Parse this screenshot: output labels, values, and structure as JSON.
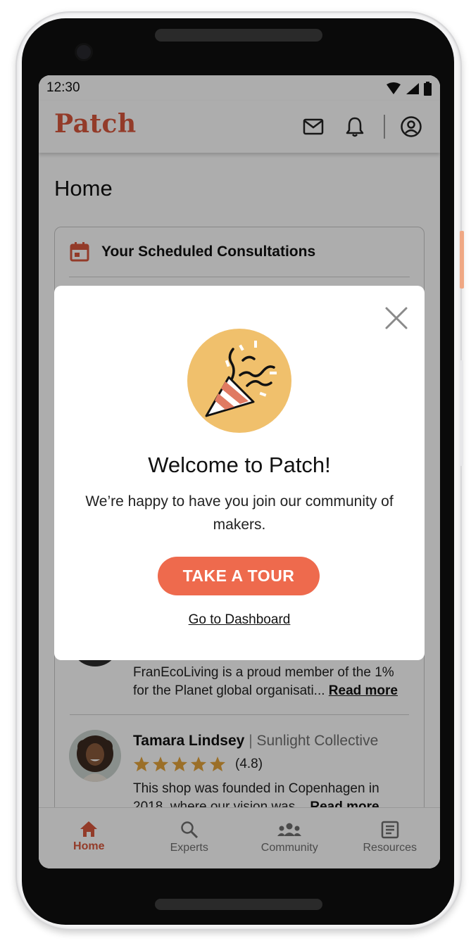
{
  "status_bar": {
    "time": "12:30"
  },
  "header": {
    "brand": "Patch"
  },
  "page": {
    "title": "Home"
  },
  "consultations": {
    "title": "Your Scheduled Consultations"
  },
  "reviews": [
    {
      "text": "FranEcoLiving is a proud member of the 1% for the Planet global organisati...",
      "read_more": "Read more"
    },
    {
      "name": "Tamara Lindsey",
      "separator": "|",
      "organization": "Sunlight Collective",
      "stars": 5,
      "rating": "(4.8)",
      "text": "This shop was founded in Copenhagen in 2018, where our vision was...",
      "read_more": "Read more"
    }
  ],
  "modal": {
    "title": "Welcome to Patch!",
    "body": "We’re happy to have you join our community of makers.",
    "primary_button": "TAKE A TOUR",
    "secondary_link": "Go to Dashboard"
  },
  "bottom_nav": {
    "items": [
      {
        "label": "Home",
        "icon": "home-icon",
        "active": true
      },
      {
        "label": "Experts",
        "icon": "search-icon",
        "active": false
      },
      {
        "label": "Community",
        "icon": "community-icon",
        "active": false
      },
      {
        "label": "Resources",
        "icon": "resources-icon",
        "active": false
      }
    ]
  },
  "colors": {
    "brand": "#d9583d",
    "accent_button": "#ee6a4d",
    "star": "#e5a43b",
    "party_circle": "#f0c06c"
  }
}
